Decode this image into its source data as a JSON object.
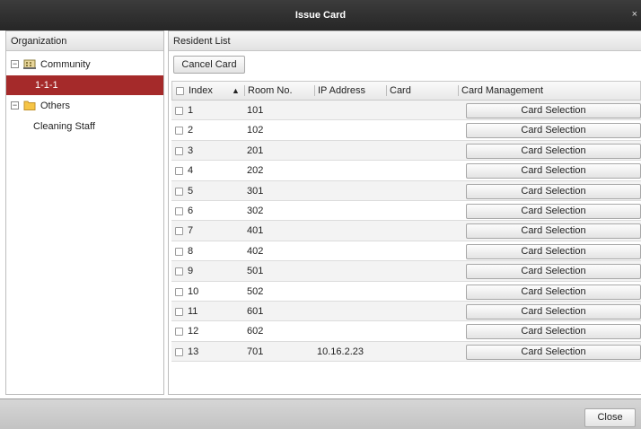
{
  "window": {
    "title": "Issue Card",
    "close_glyph": "×"
  },
  "organization": {
    "header": "Organization",
    "tree": [
      {
        "label": "Community",
        "expander": "−",
        "icon": "building-icon"
      },
      {
        "label": "1-1-1",
        "selected": true
      },
      {
        "label": "Others",
        "expander": "−",
        "icon": "folder-icon"
      },
      {
        "label": "Cleaning Staff"
      }
    ]
  },
  "resident_list": {
    "header": "Resident List",
    "cancel_card_label": "Cancel Card",
    "columns": [
      "Index",
      "Room No.",
      "IP Address",
      "Card",
      "Card Management"
    ],
    "sort_indicator": "▲",
    "rows": [
      {
        "index": "1",
        "room": "101",
        "ip": "",
        "card": "",
        "action": "Card Selection"
      },
      {
        "index": "2",
        "room": "102",
        "ip": "",
        "card": "",
        "action": "Card Selection"
      },
      {
        "index": "3",
        "room": "201",
        "ip": "",
        "card": "",
        "action": "Card Selection"
      },
      {
        "index": "4",
        "room": "202",
        "ip": "",
        "card": "",
        "action": "Card Selection"
      },
      {
        "index": "5",
        "room": "301",
        "ip": "",
        "card": "",
        "action": "Card Selection"
      },
      {
        "index": "6",
        "room": "302",
        "ip": "",
        "card": "",
        "action": "Card Selection"
      },
      {
        "index": "7",
        "room": "401",
        "ip": "",
        "card": "",
        "action": "Card Selection"
      },
      {
        "index": "8",
        "room": "402",
        "ip": "",
        "card": "",
        "action": "Card Selection"
      },
      {
        "index": "9",
        "room": "501",
        "ip": "",
        "card": "",
        "action": "Card Selection"
      },
      {
        "index": "10",
        "room": "502",
        "ip": "",
        "card": "",
        "action": "Card Selection"
      },
      {
        "index": "11",
        "room": "601",
        "ip": "",
        "card": "",
        "action": "Card Selection"
      },
      {
        "index": "12",
        "room": "602",
        "ip": "",
        "card": "",
        "action": "Card Selection"
      },
      {
        "index": "13",
        "room": "701",
        "ip": "10.16.2.23",
        "card": "",
        "action": "Card Selection"
      }
    ]
  },
  "footer": {
    "close_label": "Close"
  },
  "colors": {
    "selected_row": "#a52a2a",
    "titlebar": "#2e2e2e"
  }
}
